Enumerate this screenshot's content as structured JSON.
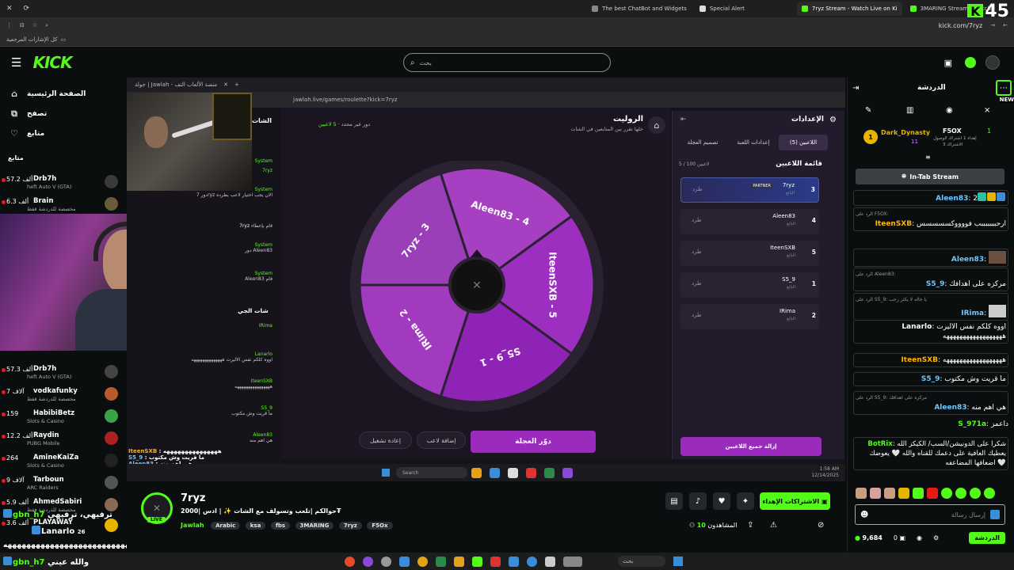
{
  "browser": {
    "tabs": [
      {
        "label": "The best ChatBot and Widgets"
      },
      {
        "label": "Special Alert"
      },
      {
        "label": "7ryz Stream - Watch Live on Ki"
      },
      {
        "label": "3MARING Stream - Watch"
      }
    ],
    "url": "kick.com/7ryz",
    "bookmarks_label": "كل الإشارات المرجعية",
    "overlay_badge": "45"
  },
  "header": {
    "logo": "KICK",
    "search_placeholder": "بحث"
  },
  "nav": {
    "items": [
      {
        "label": "الصفحة الرئيسية",
        "icon": "home-icon"
      },
      {
        "label": "تصفح",
        "icon": "browse-icon"
      },
      {
        "label": "متابع",
        "icon": "heart-icon"
      }
    ],
    "following_title": "متابع",
    "following": [
      {
        "count": "57.2 ألف",
        "name": "Drb7h",
        "category": "heft Auto V (GTA)"
      },
      {
        "count": "6.3 ألف",
        "name": "Brain",
        "category": "مخصصة للدردشة فقط"
      },
      {
        "count": "57.3 ألف",
        "name": "Drb7h",
        "category": "heft Auto V (GTA)"
      },
      {
        "count": "7 آلاف",
        "name": "vodkafunky",
        "category": "مخصصة للدردشة فقط"
      },
      {
        "count": "159",
        "name": "HabibiBetz",
        "category": "Slots & Casino"
      },
      {
        "count": "12.2 ألف",
        "name": "Raydin",
        "category": "PUBG Mobile"
      },
      {
        "count": "264",
        "name": "AmineKaiZa",
        "category": "Slots & Casino"
      },
      {
        "count": "9 آلاف",
        "name": "Tarboun",
        "category": "ARC Raiders"
      },
      {
        "count": "5.9 ألف",
        "name": "AhmedSabiri",
        "category": "مخصصة للدردشة فقط"
      },
      {
        "count": "3.6 ألف",
        "name": "PLAYAWAY",
        "category": ""
      }
    ]
  },
  "overlay_chat": {
    "line1_name": "gbn_h7",
    "line1_text": "ترفيهي، ترفيهي",
    "line2_name": "Lanarlo",
    "line2_text": "26",
    "line3_text": "ههههههههههههههههههههههههههههههه",
    "line4_name": "gbn_h7",
    "line4_text": "والله عيني"
  },
  "game": {
    "window_title": "جولة | Jawlah - منصة الألعاب التف",
    "url": "jawlah.live/games/roulette?kick=7ryz",
    "title": "الروليت",
    "subtitle": "خلها تقرر بين المتابعين في الشات",
    "players_info": "5 لاعبين",
    "round_info": "دور غير محدد",
    "wheel_segments": [
      {
        "label": "Aleen83 - 4",
        "color": "#a63fc2"
      },
      {
        "label": "IteenSXB - 5",
        "color": "#9c2fc0"
      },
      {
        "label": "S5_9 - 1",
        "color": "#8f23b6"
      },
      {
        "label": "IRima - 2",
        "color": "#a23ac0"
      },
      {
        "label": "7ryz - 3",
        "color": "#9a3fb8"
      }
    ],
    "spin_button": "دوّر العجلة",
    "add_player_button": "إضافة لاعب",
    "replay_button": "إعادة تشغيل",
    "settings_title": "الإعدادات",
    "settings_tabs": [
      "اللاعبين (5)",
      "إعدادات اللعبة",
      "تصميم العجلة"
    ],
    "players_list_title": "قائمة اللاعبين",
    "players_limit": "5 / 100 لاعبين",
    "kick_label": "طرد",
    "partner_badge": "PARTNER",
    "players": [
      {
        "name": "7ryz",
        "status": "البائع",
        "num": "3"
      },
      {
        "name": "Aleen83",
        "status": "البائع",
        "num": "4"
      },
      {
        "name": "IteenSXB",
        "status": "البائع",
        "num": "5"
      },
      {
        "name": "S5_9",
        "status": "البائع",
        "num": "1"
      },
      {
        "name": "IRima",
        "status": "البائع",
        "num": "2"
      }
    ],
    "remove_all_button": "إزالة جميع اللاعبين",
    "chat_title_1": "الشات",
    "chat_title_2": "شات الجي",
    "chat_lines": [
      {
        "name": "System",
        "text": ""
      },
      {
        "name": "7ryz",
        "text": ""
      },
      {
        "name": "System",
        "text": "دور 7ryz الان يجب اختيار لاعب بطرده"
      },
      {
        "name": "7ryz",
        "text": "قام بإعطاء"
      },
      {
        "name": "System",
        "text": "دور Aleen83"
      },
      {
        "name": "System",
        "text": "Aleen83 قام"
      }
    ],
    "game_chat_lines": [
      {
        "name": "IRima",
        "text": ""
      },
      {
        "name": "Lanarlo",
        "text": "اووه كلكم نفس الاليرت ههههههههههههههه"
      },
      {
        "name": "IteenSXB",
        "text": "ههههههههههههههههه"
      },
      {
        "name": "S5_9",
        "text": "ما قريت وش مكتوب"
      },
      {
        "name": "Aleen83",
        "text": "هي اهم منه"
      }
    ],
    "overlay_lines": [
      {
        "name": "IteenSXB",
        "text": "هههههههههههههههه"
      },
      {
        "name": "S5_9",
        "text": "ما قريت وش مكتوب"
      },
      {
        "name": "Aleen83",
        "text": "هي اهم منه"
      }
    ],
    "taskbar_search": "Search",
    "taskbar_time": "1:58 AM",
    "taskbar_date": "12/14/2025"
  },
  "stream": {
    "channel": "7ryz",
    "live_label": "LIVE",
    "title": "حوالكم |تلعب وتسولف مع الشات ✨ | ادس |2000₮",
    "category": "Jawlah",
    "tags": [
      "Arabic",
      "ksa",
      "fbs",
      "3MARING",
      "7ryz",
      "F5Ox"
    ],
    "subscribe_button": "الاشتراكات الإهداء",
    "viewers": "10",
    "viewers_label": "المشاهدون"
  },
  "chat": {
    "title": "الدردشة",
    "new_badge": "NEW",
    "leader1_name": "Dark_Dynasty",
    "leader1_rank": "1",
    "leader1_count": "11",
    "leader2_name": "F5OX",
    "leader2_rank": "1",
    "leader2_desc": "إهداء 1 اشتراك الوصول",
    "leader2_desc2": "الاشتراك 3",
    "pinned": "In-Tab Stream",
    "messages": [
      {
        "user": "Aleen83",
        "text": "2",
        "reply": "",
        "color": "#6bc7ff"
      },
      {
        "user": "IteenSXB",
        "text": "ارحبببببببب فووووكسسسسس",
        "reply": "الرد على F5OX:",
        "color": "#ffb400"
      },
      {
        "user": "Aleen83",
        "text": "",
        "reply": "",
        "color": "#6bc7ff"
      },
      {
        "user": "S5_9",
        "text": "مركزه على اهدافك",
        "reply": "الرد على Aleen83:",
        "color": "#6bc7ff"
      },
      {
        "user": "IRima",
        "text": "",
        "reply": "الرد على S5_9: يا خاله لا يكثر رحب",
        "color": "#6bc7ff"
      },
      {
        "user": "Lanarlo",
        "text": "اووه كلكم نفس الاليرت ههههههههههههههههههه",
        "reply": "",
        "color": "#ffffff"
      },
      {
        "user": "IteenSXB",
        "text": "ههههههههههههههههههه",
        "reply": "",
        "color": "#ffb400"
      },
      {
        "user": "S5_9",
        "text": "ما قريت وش مكتوب",
        "reply": "",
        "color": "#6bc7ff"
      },
      {
        "user": "Aleen83",
        "text": "هي اهم منه",
        "reply": "الرد على S5_9: مركزه على اهدافك",
        "color": "#6bc7ff"
      },
      {
        "user": "S_971a",
        "text": "داعمز",
        "reply": "",
        "color": "#53fc18"
      },
      {
        "user": "BotRix",
        "text": "شكرا على الدونيشن/السب/ الكيكز الله يعطيك العافية على دعمك للقناه والله 🤍 يعوضك اضعافها المضاعفه 🤍",
        "reply": "",
        "color": "#53fc18"
      }
    ],
    "input_placeholder": "إرسال رسالة",
    "points": "9,684",
    "points2": "0",
    "send_button": "الدردشة"
  },
  "colors": {
    "kick_green": "#53fc18",
    "purple": "#9b2bbd",
    "bg": "#0b0e0f"
  }
}
